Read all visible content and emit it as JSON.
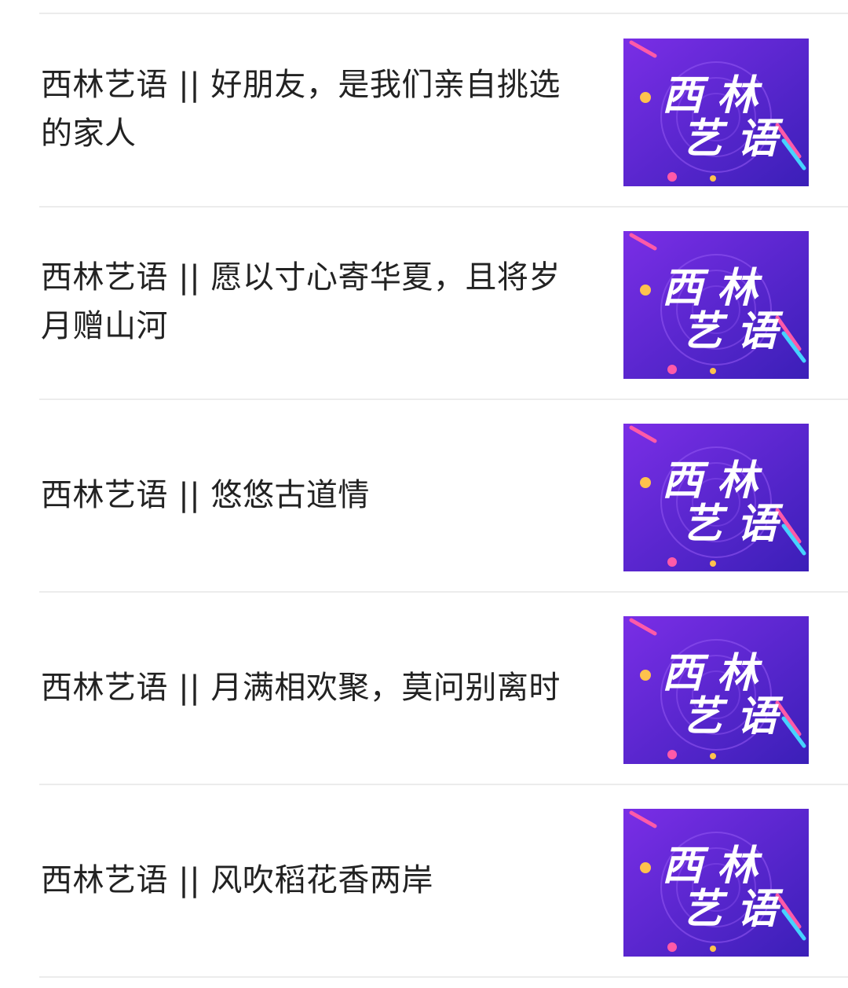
{
  "articles": [
    {
      "title": "西林艺语 || 好朋友，是我们亲自挑选的家人",
      "thumb_text": "西林艺语"
    },
    {
      "title": "西林艺语 || 愿以寸心寄华夏，且将岁月赠山河",
      "thumb_text": "西林艺语"
    },
    {
      "title": "西林艺语 || 悠悠古道情",
      "thumb_text": "西林艺语"
    },
    {
      "title": "西林艺语 || 月满相欢聚，莫问别离时",
      "thumb_text": "西林艺语"
    },
    {
      "title": "西林艺语 || 风吹稻花香两岸",
      "thumb_text": "西林艺语"
    }
  ],
  "colors": {
    "thumb_bg_start": "#7a2ee6",
    "thumb_bg_end": "#3b1fb8",
    "thumb_text": "#ffffff",
    "accent_pink": "#ff5aa8",
    "accent_cyan": "#46d3ff",
    "accent_gold": "#ffc24d"
  }
}
